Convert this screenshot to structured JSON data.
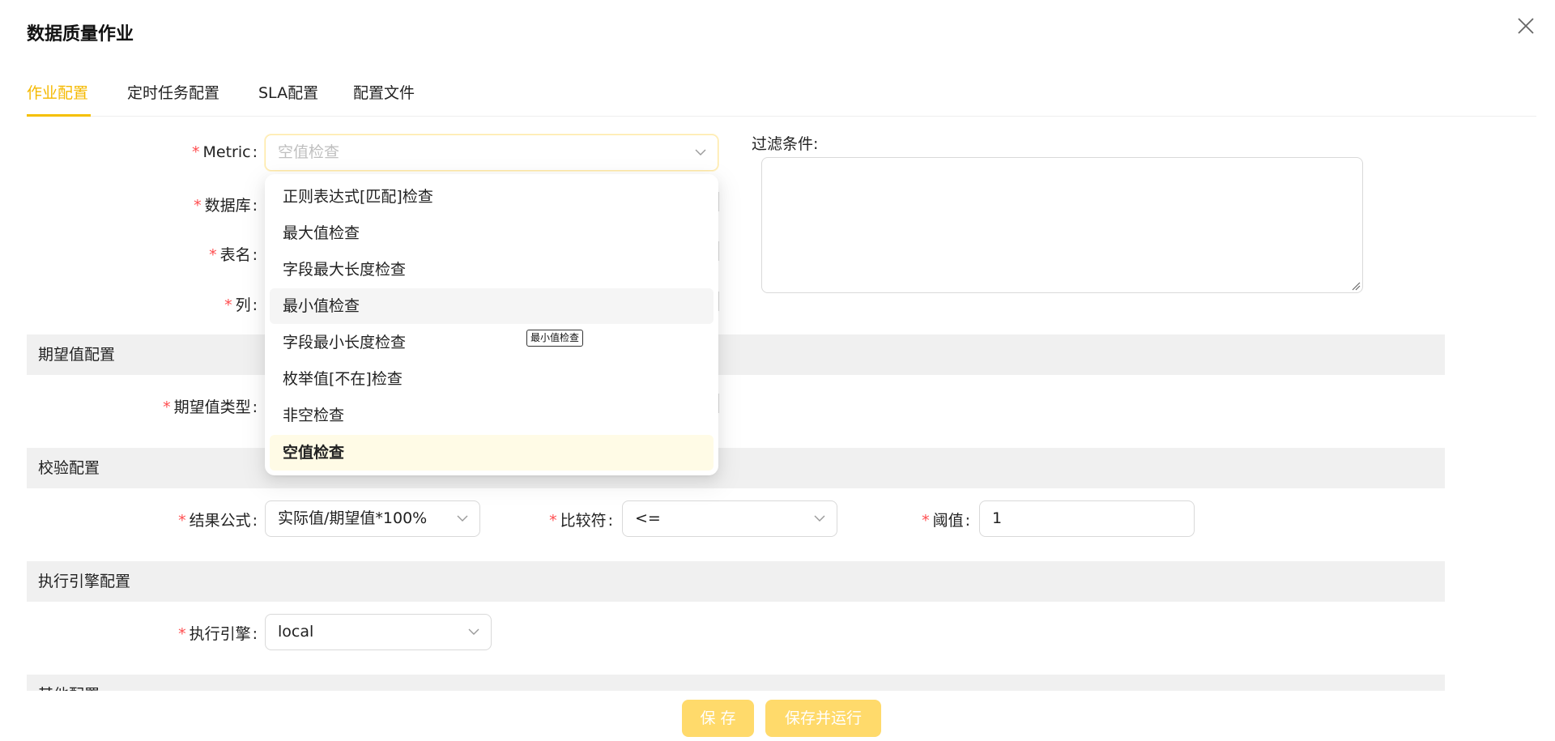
{
  "modal": {
    "title": "数据质量作业"
  },
  "tabs": [
    {
      "label": "作业配置",
      "active": true
    },
    {
      "label": "定时任务配置"
    },
    {
      "label": "SLA配置"
    },
    {
      "label": "配置文件"
    }
  ],
  "form": {
    "metric": {
      "label": "Metric",
      "placeholder": "空值检查"
    },
    "database": {
      "label": "数据库"
    },
    "table": {
      "label": "表名"
    },
    "column": {
      "label": "列"
    },
    "filter": {
      "label": "过滤条件:"
    }
  },
  "sections": {
    "expected": "期望值配置",
    "validation": "校验配置",
    "engine": "执行引擎配置",
    "other": "其他配置"
  },
  "expected": {
    "type_label": "期望值类型"
  },
  "validation": {
    "formula": {
      "label": "结果公式",
      "value": "实际值/期望值*100%"
    },
    "comparator": {
      "label": "比较符",
      "value": "<="
    },
    "threshold": {
      "label": "阈值",
      "value": "1"
    }
  },
  "engine": {
    "label": "执行引擎",
    "value": "local"
  },
  "dropdown": {
    "options": [
      "正则表达式[匹配]检查",
      "最大值检查",
      "字段最大长度检查",
      "最小值检查",
      "字段最小长度检查",
      "枚举值[不在]检查",
      "非空检查",
      "空值检查"
    ],
    "hovered": "最小值检查",
    "selected": "空值检查"
  },
  "tooltip": {
    "text": "最小值检查"
  },
  "buttons": {
    "save": "保 存",
    "save_run": "保存并运行"
  },
  "colors": {
    "accent": "#f5b900",
    "required": "#ff4d4f",
    "button_bg": "#ffda6b",
    "section_bg": "#f0f0f0"
  },
  "icons": {
    "close": "close-icon",
    "chevron": "chevron-down-icon",
    "resize": "resize-grip-icon"
  }
}
